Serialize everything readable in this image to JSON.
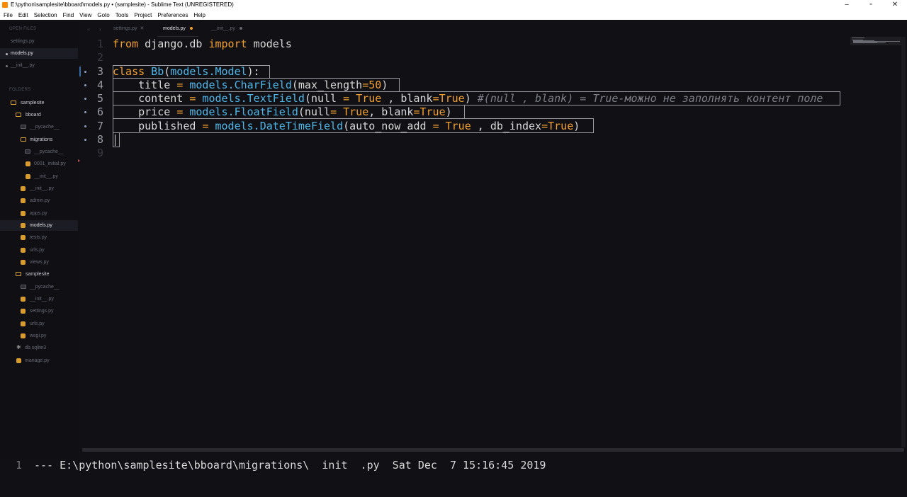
{
  "window": {
    "title": "E:\\python\\samplesite\\bboard\\models.py • (samplesite) - Sublime Text (UNREGISTERED)",
    "minimize": "–",
    "maximize": "▫",
    "close": "✕"
  },
  "menu": [
    "File",
    "Edit",
    "Selection",
    "Find",
    "View",
    "Goto",
    "Tools",
    "Project",
    "Preferences",
    "Help"
  ],
  "sidebar": {
    "open_files_label": "OPEN FILES",
    "open_files": [
      "settings.py",
      "models.py",
      "__init__.py"
    ],
    "folders_label": "FOLDERS",
    "tree": [
      {
        "label": "samplesite",
        "type": "folder"
      },
      {
        "label": "bboard",
        "type": "folder"
      },
      {
        "label": "__pycache__",
        "type": "folder-dim"
      },
      {
        "label": "migrations",
        "type": "folder"
      },
      {
        "label": "__pycache__",
        "type": "folder-dim"
      },
      {
        "label": "0001_initial.py",
        "type": "py"
      },
      {
        "label": "__init__.py",
        "type": "py"
      },
      {
        "label": "__init__.py",
        "type": "py"
      },
      {
        "label": "admin.py",
        "type": "py"
      },
      {
        "label": "apps.py",
        "type": "py"
      },
      {
        "label": "models.py",
        "type": "py"
      },
      {
        "label": "tests.py",
        "type": "py"
      },
      {
        "label": "urls.py",
        "type": "py"
      },
      {
        "label": "views.py",
        "type": "py"
      },
      {
        "label": "samplesite",
        "type": "folder"
      },
      {
        "label": "__pycache__",
        "type": "folder-dim"
      },
      {
        "label": "__init__.py",
        "type": "py"
      },
      {
        "label": "settings.py",
        "type": "py"
      },
      {
        "label": "urls.py",
        "type": "py"
      },
      {
        "label": "wsgi.py",
        "type": "py"
      },
      {
        "label": "db.sqlite3",
        "type": "db"
      },
      {
        "label": "manage.py",
        "type": "py"
      }
    ]
  },
  "tabs": [
    {
      "label": "settings.py",
      "state": "close",
      "symbol": "✕"
    },
    {
      "label": "models.py",
      "state": "modified"
    },
    {
      "label": "__init__.py",
      "state": "dot"
    }
  ],
  "nav": {
    "back": "‹",
    "forward": "›"
  },
  "editor": {
    "line_numbers": [
      "1",
      "2",
      "3",
      "4",
      "5",
      "6",
      "7",
      "8",
      "9"
    ],
    "code": {
      "l1_from": "from",
      "l1_mod": " django.db ",
      "l1_import": "import",
      "l1_name": " models",
      "l3_class": "class",
      "l3_name": " Bb",
      "l3_p1": "(",
      "l3_base": "models.Model",
      "l3_p2": "):",
      "l4_ind": "    title ",
      "l4_eq": "=",
      "l4_call": " models.CharField",
      "l4_args1": "(max_length",
      "l4_eq2": "=",
      "l4_num": "50",
      "l4_close": ")",
      "l5_ind": "    content ",
      "l5_eq": "=",
      "l5_call": " models.TextField",
      "l5_a1": "(null ",
      "l5_eq2": "=",
      "l5_sp": " ",
      "l5_t1": "True",
      "l5_a2": " , blank",
      "l5_eq3": "=",
      "l5_t2": "True",
      "l5_close": ") ",
      "l5_comment": "#(null , blank) = True-можно не заполнять контент поле",
      "l6_ind": "    price ",
      "l6_eq": "=",
      "l6_call": " models.FloatField",
      "l6_a1": "(null",
      "l6_eq2": "=",
      "l6_sp": " ",
      "l6_t1": "True",
      "l6_a2": ", blank",
      "l6_eq3": "=",
      "l6_t2": "True",
      "l6_close": ")",
      "l7_ind": "    published ",
      "l7_eq": "=",
      "l7_call": " models.DateTimeField",
      "l7_a1": "(auto_now_add ",
      "l7_eq2": "=",
      "l7_sp": " ",
      "l7_t1": "True",
      "l7_a2": " , db_index",
      "l7_eq3": "=",
      "l7_t2": "True",
      "l7_close": ")"
    }
  },
  "console": {
    "line_number": "1",
    "text": "--- E:\\python\\samplesite\\bboard\\migrations\\  init  .py  Sat Dec  7 15:16:45 2019"
  },
  "colors": {
    "background": "#101015",
    "keyword": "#f2a031",
    "function": "#4fb6e8",
    "comment": "#7e7e88",
    "folder": "#d7a23a",
    "python_file": "#d89c2e"
  }
}
